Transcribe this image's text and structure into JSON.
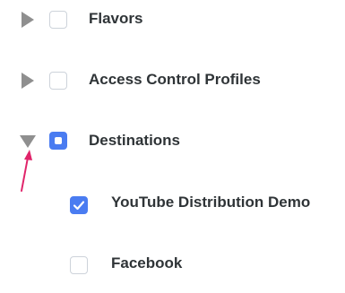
{
  "tree": {
    "items": [
      {
        "label": "Flavors",
        "expanded": false,
        "checkbox_state": "unchecked",
        "level": 0
      },
      {
        "label": "Access Control Profiles",
        "expanded": false,
        "checkbox_state": "unchecked",
        "level": 0
      },
      {
        "label": "Destinations",
        "expanded": true,
        "checkbox_state": "partial",
        "level": 0
      },
      {
        "label": "YouTube Distribution Demo",
        "checkbox_state": "checked",
        "level": 1
      },
      {
        "label": "Facebook",
        "checkbox_state": "unchecked",
        "level": 1
      }
    ]
  },
  "colors": {
    "accent": "#4a7cf1",
    "caret": "#8f8f8f",
    "text": "#2f3437",
    "annotation_arrow": "#e0246a"
  },
  "icons": {
    "expand_collapsed": "caret-right-icon",
    "expand_expanded": "caret-down-icon",
    "checkmark": "checkmark-icon",
    "annotation": "arrow-up-icon"
  }
}
